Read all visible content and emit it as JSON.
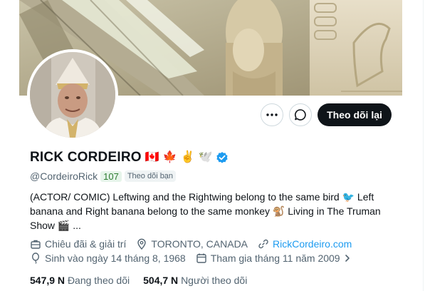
{
  "profile": {
    "name": "RICK CORDEIRO",
    "name_emojis": [
      "🇨🇦",
      "🍁",
      "✌️",
      "🕊️"
    ],
    "handle": "@CordeiroRick",
    "badge_count": "107",
    "follows_you": "Theo dõi bạn",
    "bio_text": "(ACTOR/ COMIC) Leftwing and the Rightwing belong to the same bird 🐦 Left banana and Right banana belong to the same monkey 🐒 Living in The Truman Show 🎬 ...",
    "category": "Chiêu đãi & giải trí",
    "location": "TORONTO, CANADA",
    "website": "RickCordeiro.com",
    "birthday": "Sinh vào ngày 14 tháng 8, 1968",
    "joined": "Tham gia tháng 11 năm 2009",
    "following_count": "547,9 N",
    "following_label": "Đang theo dõi",
    "followers_count": "504,7 N",
    "followers_label": "Người theo dõi"
  },
  "actions": {
    "more_icon": "more-horizontal-icon",
    "message_icon": "message-bubble-icon",
    "follow_back_label": "Theo dõi lại"
  },
  "colors": {
    "accent": "#1d9bf0",
    "follow_button": "#0f1419",
    "verified": "#1d9bf0",
    "badge_green": "#2e7d32"
  }
}
